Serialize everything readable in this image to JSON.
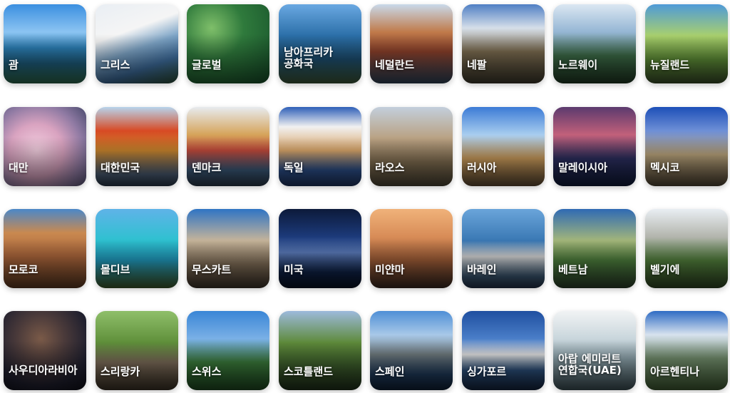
{
  "countries": [
    {
      "label": "괌"
    },
    {
      "label": "그리스"
    },
    {
      "label": "글로벌"
    },
    {
      "label": "남아프리카 공화국"
    },
    {
      "label": "네덜란드"
    },
    {
      "label": "네팔"
    },
    {
      "label": "노르웨이"
    },
    {
      "label": "뉴질랜드"
    },
    {
      "label": "대만"
    },
    {
      "label": "대한민국"
    },
    {
      "label": "덴마크"
    },
    {
      "label": "독일"
    },
    {
      "label": "라오스"
    },
    {
      "label": "러시아"
    },
    {
      "label": "말레이시아"
    },
    {
      "label": "멕시코"
    },
    {
      "label": "모로코"
    },
    {
      "label": "몰디브"
    },
    {
      "label": "무스카트"
    },
    {
      "label": "미국"
    },
    {
      "label": "미얀마"
    },
    {
      "label": "바레인"
    },
    {
      "label": "베트남"
    },
    {
      "label": "벨기에"
    },
    {
      "label": "사우디아라비아"
    },
    {
      "label": "스리랑카"
    },
    {
      "label": "스위스"
    },
    {
      "label": "스코틀랜드"
    },
    {
      "label": "스페인"
    },
    {
      "label": "싱가포르"
    },
    {
      "label": "아랍 에미리트 연합국(UAE)"
    },
    {
      "label": "아르헨티나"
    }
  ]
}
